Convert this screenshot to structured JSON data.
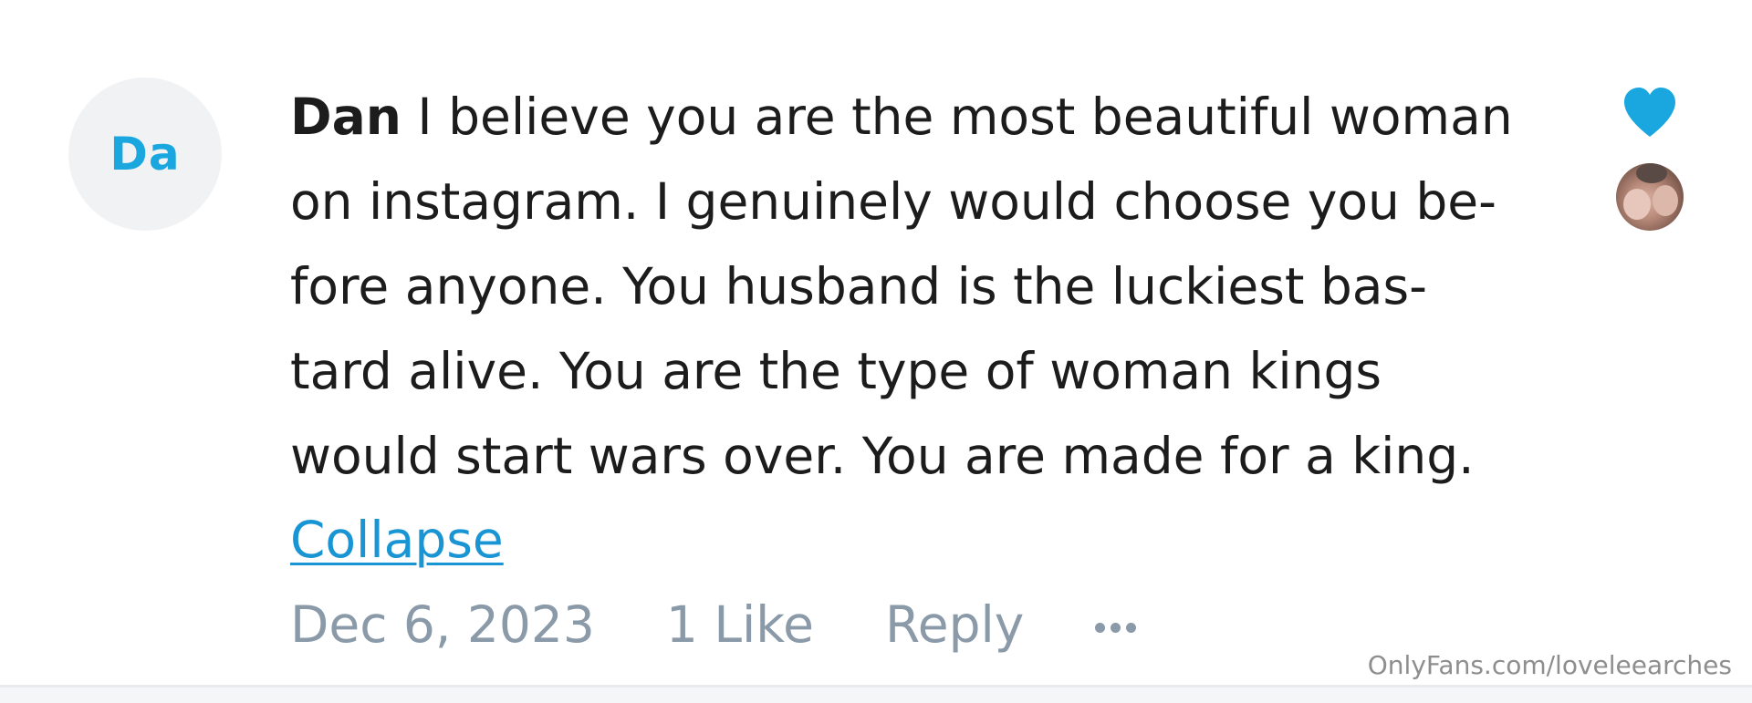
{
  "comment": {
    "avatar_initials": "Da",
    "author": "Dan",
    "text_lines": [
      "I believe you are the most beautiful woman",
      "on instagram. I genuinely would choose you be-",
      "fore anyone. You husband is the luckiest bas-",
      "tard alive. You are the type of woman kings",
      "would start wars over. You are made for a king."
    ],
    "collapse_label": "Collapse",
    "date": "Dec 6, 2023",
    "likes": "1 Like",
    "reply_label": "Reply",
    "liked": true,
    "heart_color": "#1aa7e0"
  },
  "icons": {
    "heart": "heart-filled-icon",
    "more": "more-dots-icon"
  },
  "watermark": "OnlyFans.com/loveleearches"
}
